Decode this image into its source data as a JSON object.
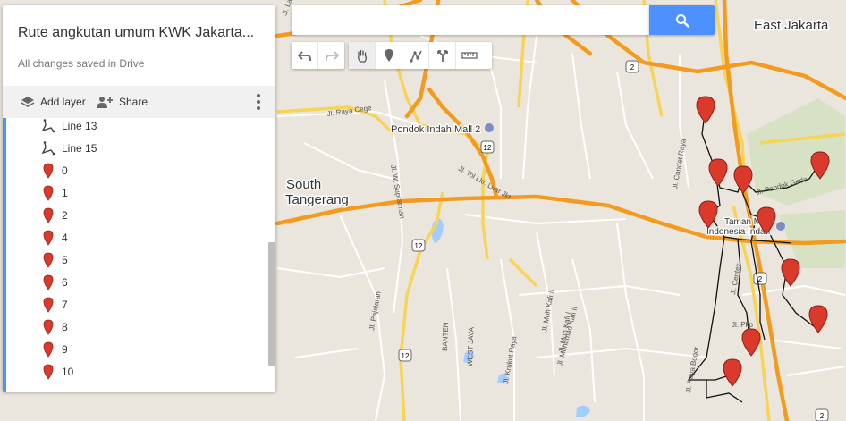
{
  "map": {
    "places": {
      "east_jakarta": "East Jakarta",
      "south_tangerang_1": "South",
      "south_tangerang_2": "Tangerang",
      "pondok_indah": "Pondok Indah Mall 2",
      "taman_mini_1": "Taman Mini",
      "taman_mini_2": "Indonesia Indah",
      "banten": "BANTEN",
      "west_java": "WEST JAVA"
    },
    "roads": {
      "raya_cege": "Jl. Raya Cege",
      "tol_lkr": "Jl. Tol Lkr. Luar Jkt",
      "w_supratman": "Jl. W. Supratman",
      "pajajaran": "Jl. Pajajaran",
      "kukruf": "Jl. Krukut Raya",
      "moh_kafi": "Jl. Moh Kafi II",
      "moh_kafi_1": "Jl. Moh Kafi I",
      "mohamad_kafi": "Jl. Mohamad Kafi II",
      "condet": "Jl. Condet Raya",
      "pondok_gede": "Jl. Pondok Gede",
      "pkp": "Jl. Pkp",
      "raya_bogor": "Jl. Raya Bogor",
      "centex": "Jl. Centex",
      "lapangan": "Jl. Lapangan"
    },
    "shields": [
      "2",
      "12",
      "12",
      "12",
      "2",
      "2"
    ],
    "colors": {
      "land": "#ebe6dd",
      "highway": "#f29b1f",
      "major": "#f7d358",
      "minor": "#ffffff",
      "water": "#a3ccff",
      "park": "#c9dcad",
      "route": "#111111",
      "pin": "#d93a2b"
    }
  },
  "panel": {
    "title": "Rute angkutan umum KWK Jakarta...",
    "saved": "All changes saved in Drive",
    "add_layer": "Add layer",
    "share": "Share",
    "items": [
      {
        "label": "Line 13",
        "icon": "line-route-icon"
      },
      {
        "label": "Line 15",
        "icon": "line-route-icon"
      },
      {
        "label": "0",
        "icon": "map-pin-icon"
      },
      {
        "label": "1",
        "icon": "map-pin-icon"
      },
      {
        "label": "2",
        "icon": "map-pin-icon"
      },
      {
        "label": "4",
        "icon": "map-pin-icon"
      },
      {
        "label": "5",
        "icon": "map-pin-icon"
      },
      {
        "label": "6",
        "icon": "map-pin-icon"
      },
      {
        "label": "7",
        "icon": "map-pin-icon"
      },
      {
        "label": "8",
        "icon": "map-pin-icon"
      },
      {
        "label": "9",
        "icon": "map-pin-icon"
      },
      {
        "label": "10",
        "icon": "map-pin-icon"
      }
    ]
  },
  "search": {
    "placeholder": ""
  },
  "tools": [
    "undo-icon",
    "redo-icon",
    "pan-hand-icon",
    "add-marker-icon",
    "draw-line-icon",
    "directions-icon",
    "measure-ruler-icon"
  ]
}
